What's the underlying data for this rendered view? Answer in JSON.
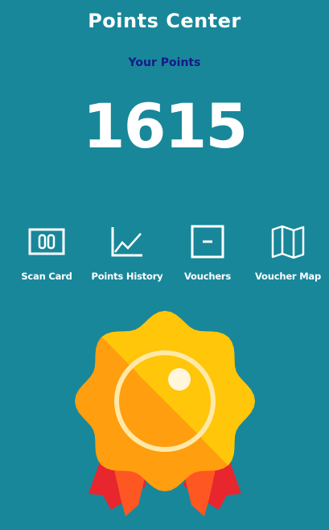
{
  "header": {
    "title": "Points Center"
  },
  "points": {
    "label": "Your Points",
    "value": "1615"
  },
  "actions": [
    {
      "label": "Scan Card",
      "icon": "scan-card-icon"
    },
    {
      "label": "Points History",
      "icon": "chart-icon"
    },
    {
      "label": "Vouchers",
      "icon": "voucher-icon"
    },
    {
      "label": "Voucher Map",
      "icon": "map-icon"
    }
  ],
  "colors": {
    "background": "#18879a",
    "accent_text": "#161a86",
    "badge_orange": "#ff9e0e",
    "badge_yellow": "#ffc60a",
    "ribbon_red": "#e8262e"
  }
}
